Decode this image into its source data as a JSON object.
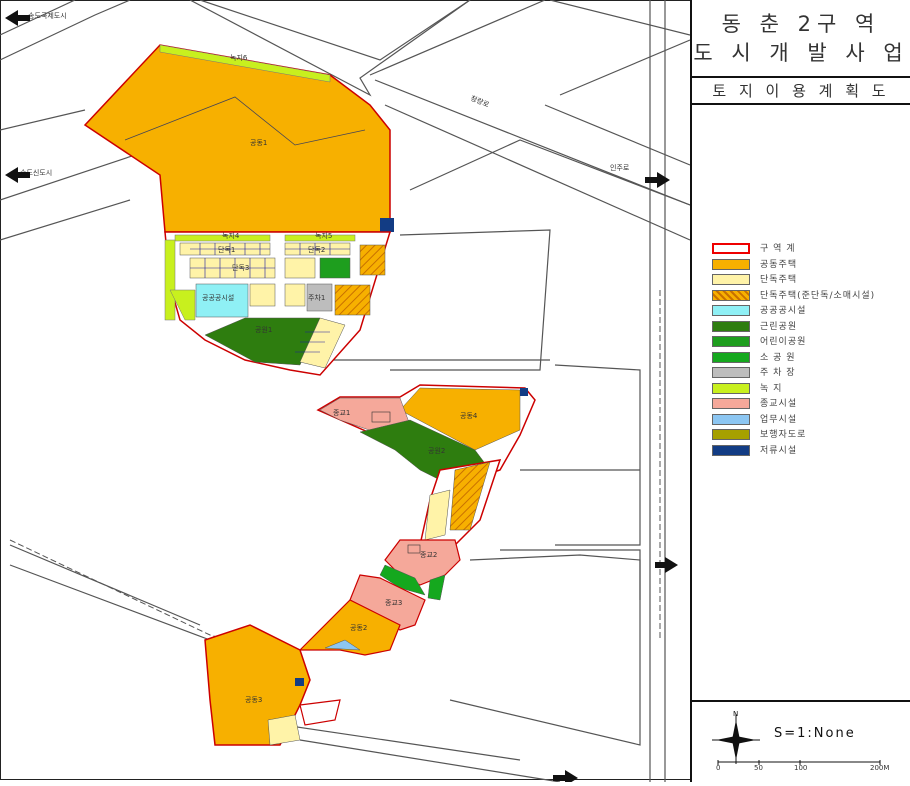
{
  "title": {
    "line1": "동 춘 2구 역",
    "line2": "도 시 개 발 사 업"
  },
  "subtitle": "토 지 이 용 계 획 도",
  "legend": [
    {
      "label": "구 역 계",
      "color": "#ffffff",
      "pattern": "boundary"
    },
    {
      "label": "공동주택",
      "color": "#f7b000",
      "pattern": "solid"
    },
    {
      "label": "단독주택",
      "color": "#fff3a8",
      "pattern": "solid"
    },
    {
      "label": "단독주택(준단독/소매시설)",
      "color": "#f7b000",
      "pattern": "hatch"
    },
    {
      "label": "공공공시설",
      "color": "#8ff0f5",
      "pattern": "solid"
    },
    {
      "label": "근린공원",
      "color": "#2e7d0f",
      "pattern": "solid"
    },
    {
      "label": "어린이공원",
      "color": "#1e9e1e",
      "pattern": "solid"
    },
    {
      "label": "소 공 원",
      "color": "#15a81e",
      "pattern": "solid"
    },
    {
      "label": "주 차 장",
      "color": "#bdbdbd",
      "pattern": "solid"
    },
    {
      "label": "녹      지",
      "color": "#c8f01e",
      "pattern": "solid"
    },
    {
      "label": "종교시설",
      "color": "#f5a89a",
      "pattern": "solid"
    },
    {
      "label": "업무시설",
      "color": "#8cc6f2",
      "pattern": "solid"
    },
    {
      "label": "보행자도로",
      "color": "#a6a000",
      "pattern": "solid"
    },
    {
      "label": "저류시설",
      "color": "#123c84",
      "pattern": "solid"
    }
  ],
  "scale": {
    "text": "S=1:None",
    "ticks": [
      "0",
      "50",
      "100",
      "200M"
    ]
  },
  "map_labels": {
    "apt1": "공동1",
    "apt2": "공동2",
    "apt3": "공동3",
    "apt4": "공동4",
    "park1": "공원1",
    "park2": "공원2",
    "green6": "녹지6",
    "green4": "녹지4",
    "green5": "녹지5",
    "house1": "단독1",
    "house2": "단독2",
    "house3": "단독3",
    "public": "공공공시설",
    "parking": "주차1",
    "religion1": "종교1",
    "religion2": "종교2",
    "religion3": "종교3",
    "road_nw": "송도국제도시",
    "road_w": "송도신도시",
    "road_ne": "청량로",
    "road_e": "인주로"
  }
}
